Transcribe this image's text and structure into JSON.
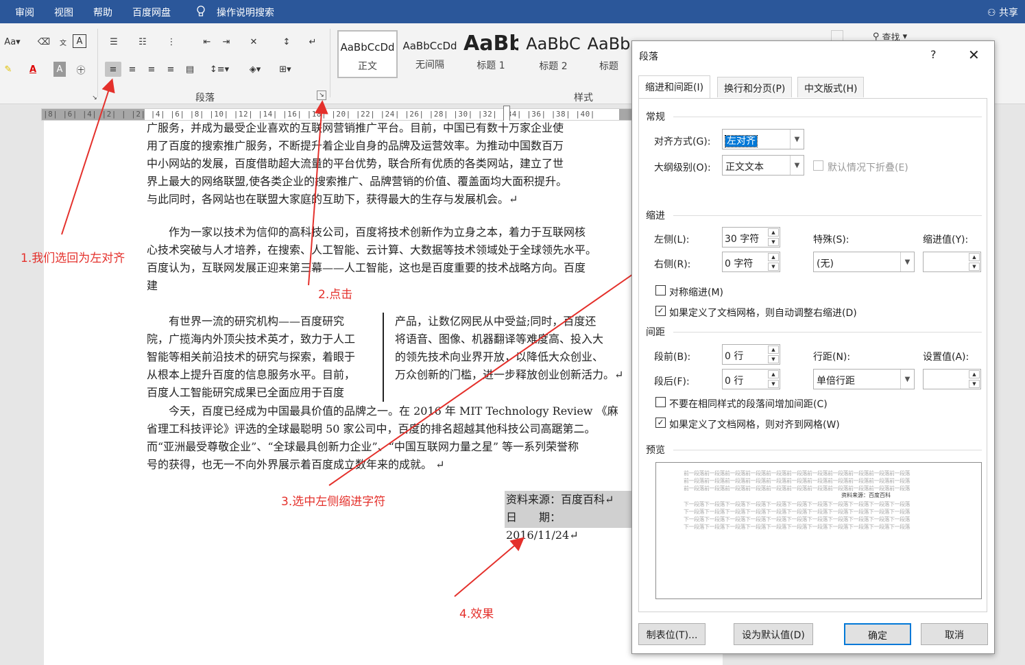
{
  "tabs": {
    "review": "审阅",
    "view": "视图",
    "help": "帮助",
    "baidu_pan": "百度网盘",
    "tell_me": "操作说明搜索",
    "share": "共享"
  },
  "ribbon": {
    "paragraph_label": "段落",
    "styles_label": "样式",
    "find_label": "查找",
    "font_size_label": "Aa",
    "styles": [
      {
        "sample": "AaBbCcDd",
        "name": "正文"
      },
      {
        "sample": "AaBbCcDd",
        "name": "无间隔"
      },
      {
        "sample": "AaBb",
        "name": "标题 1"
      },
      {
        "sample": "AaBbC",
        "name": "标题 2"
      },
      {
        "sample": "AaBb",
        "name": "标题"
      }
    ]
  },
  "ruler": {
    "numbers": "|8| |6| |4| |2| |   |2| |4| |6| |8| |10| |12| |14| |16| |18| |20| |22| |24| |26| |28| |30| |32| |34| |36| |38| |40|"
  },
  "document": {
    "para1": [
      "广服务，并成为最受企业喜欢的互联网营销推广平台。目前，中国已有数十万家企业使",
      "用了百度的搜索推广服务，不断提升着企业自身的品牌及运营效率。为推动中国数百万",
      "中小网站的发展，百度借助超大流量的平台优势，联合所有优质的各类网站，建立了世",
      "界上最大的网络联盟,使各类企业的搜索推广、品牌营销的价值、覆盖面均大面积提升。",
      "与此同时，各网站也在联盟大家庭的互助下，获得最大的生存与发展机会。↵"
    ],
    "para2": [
      "作为一家以技术为信仰的高科技公司，百度将技术创新作为立身之本，着力于互联网核",
      "心技术突破与人才培养，在搜索、人工智能、云计算、大数据等技术领域处于全球领先水平。",
      "百度认为，互联网发展正迎来第三幕——人工智能，这也是百度重要的技术战略方向。百度",
      "建"
    ],
    "col_left": [
      "有世界一流的研究机构——百度研究",
      "院，广揽海内外顶尖技术英才，致力于人工",
      "智能等相关前沿技术的研究与探索，着眼于",
      "从根本上提升百度的信息服务水平。目前，",
      "百度人工智能研究成果已全面应用于百度"
    ],
    "col_right": [
      "产品，让数亿网民从中受益;同时，百度还",
      "将语音、图像、机器翻译等难度高、投入大",
      "的领先技术向业界开放，以降低大众创业、",
      "万众创新的门槛，进一步释放创业创新活力。↵"
    ],
    "para3": [
      "今天，百度已经成为中国最具价值的品牌之一。在 2016 年 MIT Technology Review 《麻",
      "省理工科技评论》评选的全球最聪明 50 家公司中，百度的排名超越其他科技公司高踞第二。",
      "而“亚洲最受尊敬企业”、“全球最具创新力企业”、“中国互联网力量之星” 等一系列荣誉称",
      "号的获得，也无一不向外界展示着百度成立数年来的成就。 ↵"
    ],
    "source_line": "资料来源：百度百科↵",
    "date_line": "日　　期：2016/11/24↵"
  },
  "annotations": {
    "a1": "1.我们选回为左对齐",
    "a2": "2.点击",
    "a3": "3.选中左侧缩进字符",
    "a4": "4.效果"
  },
  "dialog": {
    "title": "段落",
    "help": "?",
    "close": "✕",
    "tabs": [
      "缩进和间距(I)",
      "换行和分页(P)",
      "中文版式(H)"
    ],
    "general_title": "常规",
    "alignment_label": "对齐方式(G):",
    "alignment_value": "左对齐",
    "outline_label": "大纲级别(O):",
    "outline_value": "正文文本",
    "collapse_label": "默认情况下折叠(E)",
    "indent_title": "缩进",
    "left_label": "左侧(L):",
    "left_value": "30 字符",
    "right_label": "右侧(R):",
    "right_value": "0 字符",
    "special_label": "特殊(S):",
    "special_value": "(无)",
    "indent_by_label": "缩进值(Y):",
    "mirror_label": "对称缩进(M)",
    "auto_right_label": "如果定义了文档网格，则自动调整右缩进(D)",
    "spacing_title": "间距",
    "before_label": "段前(B):",
    "before_value": "0 行",
    "after_label": "段后(F):",
    "after_value": "0 行",
    "line_spacing_label": "行距(N):",
    "line_spacing_value": "单倍行距",
    "at_label": "设置值(A):",
    "no_space_label": "不要在相同样式的段落间增加间距(C)",
    "snap_grid_label": "如果定义了文档网格，则对齐到网格(W)",
    "preview_title": "预览",
    "preview_prev": "前一段落前一段落前一段落前一段落前一段落前一段落前一段落前一段落前一段落前一段落前一段落",
    "preview_center": "资料来源：百度百科",
    "preview_next": "下一段落下一段落下一段落下一段落下一段落下一段落下一段落下一段落下一段落下一段落下一段落",
    "btn_tabs": "制表位(T)...",
    "btn_default": "设为默认值(D)",
    "btn_ok": "确定",
    "btn_cancel": "取消"
  }
}
